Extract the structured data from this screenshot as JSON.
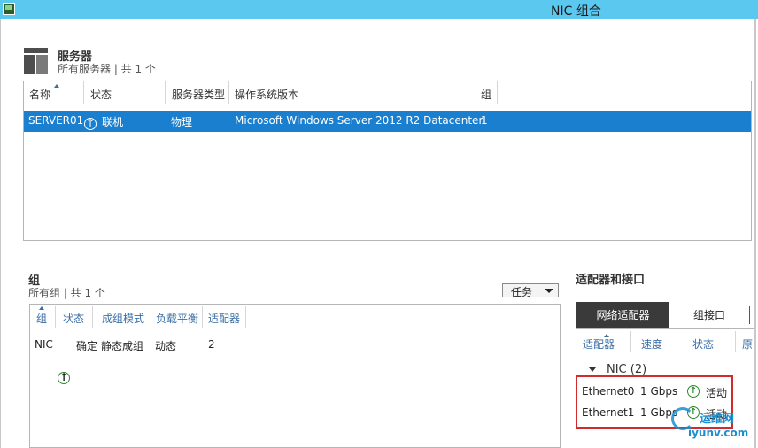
{
  "window": {
    "title": "NIC 组合"
  },
  "servers": {
    "title": "服务器",
    "subtitle": "所有服务器 | 共 1 个",
    "columns": [
      "名称",
      "状态",
      "服务器类型",
      "操作系统版本",
      "组"
    ],
    "rows": [
      {
        "name": "SERVER01",
        "status": "联机",
        "type": "物理",
        "os": "Microsoft Windows Server 2012 R2 Datacenter",
        "group": "1"
      }
    ]
  },
  "groups": {
    "title": "组",
    "subtitle": "所有组 | 共 1 个",
    "tasks_label": "任务",
    "columns": [
      "组",
      "状态",
      "成组模式",
      "负载平衡",
      "适配器"
    ],
    "rows": [
      {
        "group": "NIC",
        "status": "确定",
        "mode": "静态成组",
        "balance": "动态",
        "adapters": "2"
      }
    ]
  },
  "adapters": {
    "title": "适配器和接口",
    "tabs": [
      "网络适配器",
      "组接口"
    ],
    "columns": [
      "适配器",
      "速度",
      "状态",
      "原"
    ],
    "group_header": "NIC (2)",
    "rows": [
      {
        "name": "Ethernet0",
        "speed": "1 Gbps",
        "status": "活动"
      },
      {
        "name": "Ethernet1",
        "speed": "1 Gbps",
        "status": "活动"
      }
    ]
  },
  "watermark": {
    "text": "运维网",
    "url": "iyunv.com"
  },
  "icons": {
    "app": "nic-teaming-app-icon",
    "server": "server-group-icon",
    "status_up": "status-up-arrow-icon",
    "sort": "sort-ascending-icon",
    "dropdown": "chevron-down-icon",
    "expand": "expand-triangle-icon"
  },
  "colors": {
    "title_bar": "#5bc8f0",
    "selection": "#1a7fcf",
    "tab_active": "#3a3a3a",
    "highlight_box": "#d22b2b",
    "status_ok": "#2d8a2d"
  }
}
